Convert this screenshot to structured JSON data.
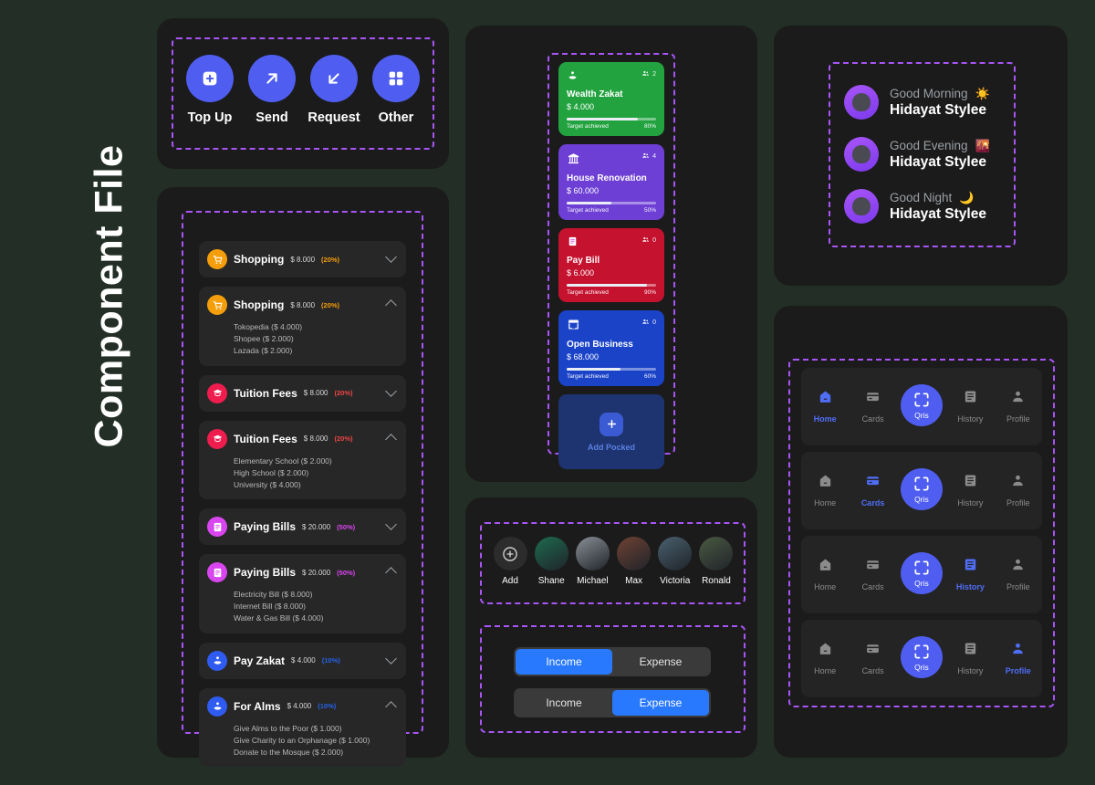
{
  "page": {
    "title": "Component File",
    "bg": "#232f26",
    "panel_bg": "#1b1b1b",
    "dash_color": "#a855f7",
    "accent": "#4f5ef0"
  },
  "quick_actions": {
    "items": [
      {
        "label": "Top Up",
        "icon": "plus-square-icon"
      },
      {
        "label": "Send",
        "icon": "arrow-up-right-icon"
      },
      {
        "label": "Request",
        "icon": "arrow-down-left-icon"
      },
      {
        "label": "Other",
        "icon": "grid-icon"
      }
    ]
  },
  "accordion": {
    "items": [
      {
        "name": "Shopping",
        "amount": "$ 8.000",
        "percent": "(20%)",
        "percent_color": "#f59e0b",
        "icon": "shopping-cart-icon",
        "icon_color": "#f59e0b",
        "expanded": false,
        "children": []
      },
      {
        "name": "Shopping",
        "amount": "$ 8.000",
        "percent": "(20%)",
        "percent_color": "#f59e0b",
        "icon": "shopping-cart-icon",
        "icon_color": "#f59e0b",
        "expanded": true,
        "children": [
          "Tokopedia ($ 4.000)",
          "Shopee ($ 2.000)",
          "Lazada ($ 2.000)"
        ]
      },
      {
        "name": "Tuition Fees",
        "amount": "$ 8.000",
        "percent": "(20%)",
        "percent_color": "#ef4444",
        "icon": "graduation-cap-icon",
        "icon_color": "#ef1d4e",
        "expanded": false,
        "children": []
      },
      {
        "name": "Tuition Fees",
        "amount": "$ 8.000",
        "percent": "(20%)",
        "percent_color": "#ef4444",
        "icon": "graduation-cap-icon",
        "icon_color": "#ef1d4e",
        "expanded": true,
        "children": [
          "Elementary School ($ 2.000)",
          "High School ($ 2.000)",
          "University ($ 4.000)"
        ]
      },
      {
        "name": "Paying Bills",
        "amount": "$ 20.000",
        "percent": "(50%)",
        "percent_color": "#d946ef",
        "icon": "receipt-icon",
        "icon_color": "#d946ef",
        "expanded": false,
        "children": []
      },
      {
        "name": "Paying Bills",
        "amount": "$ 20.000",
        "percent": "(50%)",
        "percent_color": "#d946ef",
        "icon": "receipt-icon",
        "icon_color": "#d946ef",
        "expanded": true,
        "children": [
          "Electricity Bill ($ 8.000)",
          "Internet Bill ($ 8.000)",
          "Water  & Gas Bill ($ 4.000)"
        ]
      },
      {
        "name": "Pay Zakat",
        "amount": "$ 4.000",
        "percent": "(10%)",
        "percent_color": "#2563eb",
        "icon": "charity-hand-icon",
        "icon_color": "#2f5bf0",
        "expanded": false,
        "children": []
      },
      {
        "name": "For Alms",
        "amount": "$ 4.000",
        "percent": "(10%)",
        "percent_color": "#2563eb",
        "icon": "charity-hand-icon",
        "icon_color": "#2f5bf0",
        "expanded": true,
        "children": [
          "Give Alms to the Poor ($ 1.000)",
          "Give Charity to an Orphanage ($ 1.000)",
          "Donate to the Mosque ($ 2.000)"
        ]
      }
    ]
  },
  "pockets": {
    "footer_label": "Target achieved",
    "add_label": "Add Pocked",
    "items": [
      {
        "title": "Wealth Zakat",
        "amount": "$ 4.000",
        "members": "2",
        "progress": "80%",
        "color": "#22a33f",
        "icon": "charity-hand-icon"
      },
      {
        "title": "House Renovation",
        "amount": "$ 60.000",
        "members": "4",
        "progress": "50%",
        "color": "#6d3fd4",
        "icon": "bank-icon"
      },
      {
        "title": "Pay Bill",
        "amount": "$ 6.000",
        "members": "0",
        "progress": "90%",
        "color": "#c4122f",
        "icon": "receipt-icon"
      },
      {
        "title": "Open Business",
        "amount": "$ 68.000",
        "members": "0",
        "progress": "60%",
        "color": "#1b43c8",
        "icon": "store-icon"
      }
    ]
  },
  "contacts": {
    "items": [
      {
        "name": "Add",
        "avatar": "add-icon",
        "color": "#2c2c2c"
      },
      {
        "name": "Shane",
        "avatar": "photo-avatar",
        "color": "#1d6b4f"
      },
      {
        "name": "Michael",
        "avatar": "photo-avatar",
        "color": "#8a8f96"
      },
      {
        "name": "Max",
        "avatar": "photo-avatar",
        "color": "#6f4233"
      },
      {
        "name": "Victoria",
        "avatar": "photo-avatar",
        "color": "#49606e"
      },
      {
        "name": "Ronald",
        "avatar": "photo-avatar",
        "color": "#4a5a42"
      }
    ]
  },
  "toggles": [
    {
      "left": "Income",
      "right": "Expense",
      "active": "left"
    },
    {
      "left": "Income",
      "right": "Expense",
      "active": "right"
    }
  ],
  "greetings": {
    "items": [
      {
        "greeting": "Good Morning",
        "name": "Hidayat Stylee",
        "emoji": "☀️",
        "icon": "sun-icon"
      },
      {
        "greeting": "Good Evening",
        "name": "Hidayat Stylee",
        "emoji": "🌇",
        "icon": "sunset-icon"
      },
      {
        "greeting": "Good Night",
        "name": "Hidayat Stylee",
        "emoji": "🌙",
        "icon": "moon-icon"
      }
    ]
  },
  "navbars": {
    "items": [
      "Home",
      "Cards",
      "Qris",
      "History",
      "Profile"
    ],
    "bars": [
      {
        "active": "Home"
      },
      {
        "active": "Cards"
      },
      {
        "active": "History"
      },
      {
        "active": "Profile"
      }
    ]
  }
}
